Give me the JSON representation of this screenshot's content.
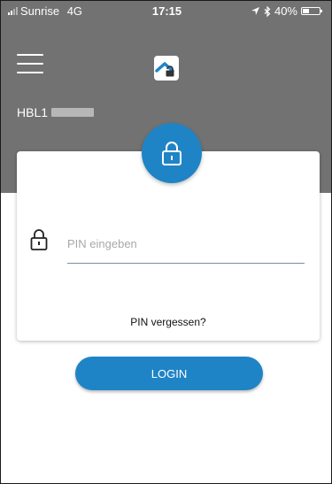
{
  "status_bar": {
    "carrier": "Sunrise",
    "network": "4G",
    "time": "17:15",
    "battery": "40%",
    "battery_level": 0.4
  },
  "header": {
    "account_prefix": "HBL1"
  },
  "form": {
    "pin_placeholder": "PIN eingeben",
    "pin_value": "",
    "forgot_label": "PIN vergessen?"
  },
  "login_label": "LOGIN",
  "colors": {
    "header_bg": "#727272",
    "accent": "#1f84c6",
    "input_underline": "#7e8aaa"
  },
  "icons": {
    "menu": "hamburger-menu-icon",
    "logo": "house-lock-logo-icon",
    "badge": "padlock-icon",
    "field": "padlock-outline-icon",
    "location": "location-arrow-icon",
    "bluetooth": "bluetooth-icon",
    "battery": "battery-icon"
  }
}
